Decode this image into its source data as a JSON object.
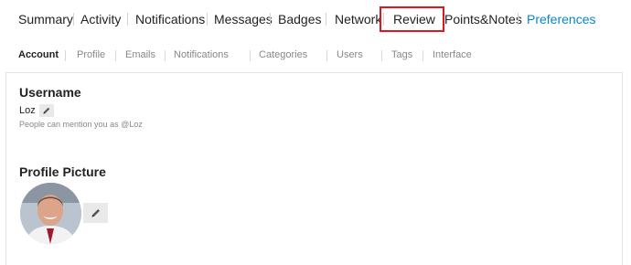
{
  "top_nav": {
    "items": [
      {
        "label": "Summary"
      },
      {
        "label": "Activity"
      },
      {
        "label": "Notifications"
      },
      {
        "label": "Messages"
      },
      {
        "label": "Badges"
      },
      {
        "label": "Network"
      },
      {
        "label": "Review"
      },
      {
        "label": "Points&Notes"
      },
      {
        "label": "Preferences"
      }
    ],
    "active": "Preferences",
    "highlighted": "Review"
  },
  "sub_nav": {
    "items": [
      {
        "label": "Account"
      },
      {
        "label": "Profile"
      },
      {
        "label": "Emails"
      },
      {
        "label": "Notifications"
      },
      {
        "label": "Categories"
      },
      {
        "label": "Users"
      },
      {
        "label": "Tags"
      },
      {
        "label": "Interface"
      }
    ],
    "active": "Account"
  },
  "account": {
    "username_title": "Username",
    "username_value": "Loz",
    "mention_hint": "People can mention you as @Loz",
    "profile_picture_title": "Profile Picture"
  },
  "colors": {
    "accent": "#0a86c9",
    "highlight_border": "#e0161e",
    "muted_text": "#888888"
  },
  "icons": {
    "edit": "pencil-icon"
  }
}
